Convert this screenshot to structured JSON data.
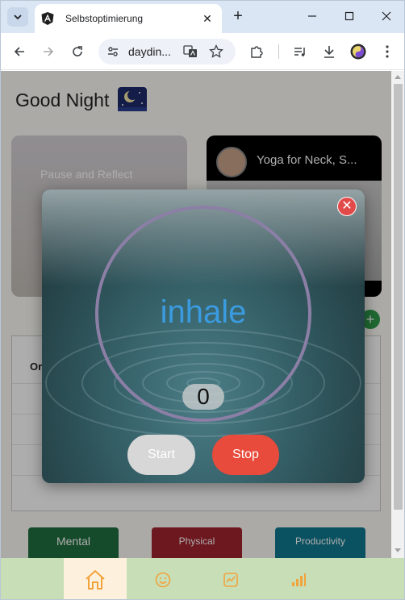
{
  "browser": {
    "tab_title": "Selbstoptimierung",
    "url": "daydin..."
  },
  "page": {
    "greeting": "Good Night",
    "greeting_emoji": "night-sky-emoji",
    "card_pause_label": "Pause and Reflect",
    "card_yoga_title": "Yoga for Neck, S...",
    "table_header": "Or",
    "categories": [
      {
        "label": "Mental",
        "color": "#1f6f3f"
      },
      {
        "label": "Physical",
        "color": "#a1222e"
      },
      {
        "label": "Productivity",
        "color": "#0f7890"
      }
    ]
  },
  "modal": {
    "phase": "inhale",
    "counter": "0",
    "start_label": "Start",
    "stop_label": "Stop",
    "ring_color": "#8c7fa6",
    "phase_color": "#3b9be0"
  },
  "bottom_nav": {
    "items": [
      {
        "icon": "home-icon",
        "active": true
      },
      {
        "icon": "smiley-icon",
        "active": false
      },
      {
        "icon": "chart-line-icon",
        "active": false
      },
      {
        "icon": "bar-chart-icon",
        "active": false
      }
    ],
    "accent": "#f2a33c"
  }
}
